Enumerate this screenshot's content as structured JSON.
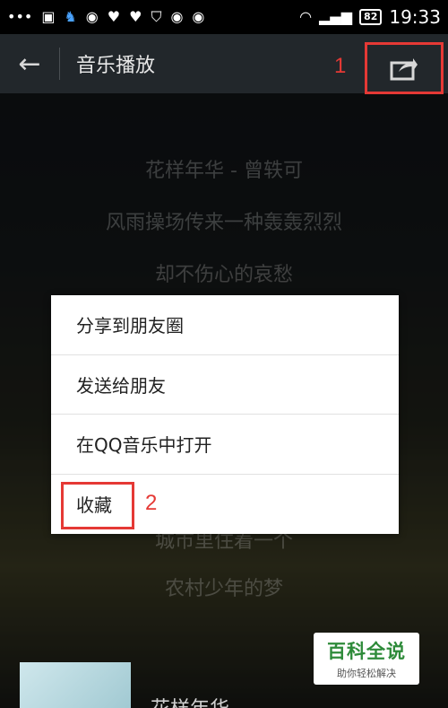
{
  "status_bar": {
    "time": "19:33",
    "battery": "82",
    "left_icons": [
      "more-icon",
      "image-icon",
      "qq-icon",
      "circle-icon",
      "shield-icon",
      "shield-icon",
      "shield-alert-icon",
      "circle-icon",
      "circle-icon"
    ],
    "right_icons": [
      "wifi-icon",
      "signal-icon",
      "battery-icon"
    ]
  },
  "app_bar": {
    "back_icon": "back-arrow-icon",
    "title": "音乐播放",
    "share_icon": "share-icon",
    "annotation": "1"
  },
  "lyrics": [
    "花样年华 - 曾轶可",
    "风雨操场传来一种轰轰烈烈",
    "却不伤心的哀愁",
    "城市里住着一个",
    "农村少年的梦"
  ],
  "menu": {
    "items": [
      {
        "label": "分享到朋友圈"
      },
      {
        "label": "发送给朋友"
      },
      {
        "label": "在QQ音乐中打开"
      },
      {
        "label": "收藏"
      }
    ],
    "annotation": "2"
  },
  "now_playing": {
    "title": "花样年华"
  },
  "watermark": {
    "main": "百科全说",
    "sub": "助你轻松解决"
  },
  "colors": {
    "annotation_red": "#e53935",
    "watermark_green": "#2e8b3a"
  }
}
